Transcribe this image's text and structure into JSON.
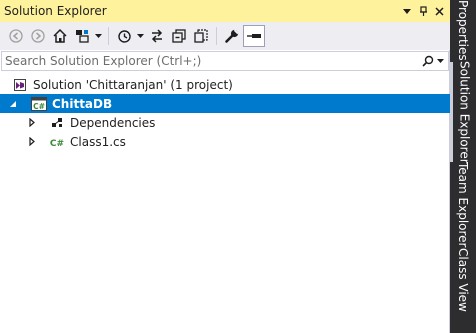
{
  "window": {
    "title": "Solution Explorer",
    "pin_glyph": "▾",
    "autohide_glyph": "⊣",
    "close_glyph": "✕"
  },
  "toolbar": {
    "buttons": [
      {
        "name": "back-button",
        "icon": "arrow-left-icon"
      },
      {
        "name": "forward-button",
        "icon": "arrow-right-icon"
      },
      {
        "name": "home-button",
        "icon": "home-icon"
      },
      {
        "name": "switch-views-button",
        "icon": "switch-views-icon"
      },
      {
        "name": "pending-changes-filter-button",
        "icon": "history-icon"
      },
      {
        "name": "sync-with-document-button",
        "icon": "sync-icon"
      },
      {
        "name": "collapse-all-button",
        "icon": "collapse-all-icon"
      },
      {
        "name": "show-all-files-button",
        "icon": "show-all-files-icon"
      },
      {
        "name": "properties-button",
        "icon": "wrench-icon"
      },
      {
        "name": "preview-selected-items-button",
        "icon": "preview-icon"
      }
    ]
  },
  "search": {
    "placeholder": "Search Solution Explorer (Ctrl+;)"
  },
  "tree": {
    "solution": {
      "label": "Solution 'Chittaranjan' (1 project)",
      "icon": "solution-icon"
    },
    "project": {
      "label": "ChittaDB",
      "icon": "csharp-project-icon",
      "badge": "C#",
      "expanded": true,
      "selected": true
    },
    "children": [
      {
        "label": "Dependencies",
        "icon": "dependencies-icon",
        "expanded": false
      },
      {
        "label": "Class1.cs",
        "icon": "csharp-file-icon",
        "badge": "C#",
        "expanded": false
      }
    ]
  },
  "side_tabs": [
    {
      "label": "Properties",
      "active": false
    },
    {
      "label": "Solution Explorer",
      "active": true
    },
    {
      "label": "Team Explorer",
      "active": false
    },
    {
      "label": "Class View",
      "active": false
    }
  ],
  "colors": {
    "title_bar": "#fff29d",
    "toolbar_bg": "#eeeef2",
    "selection": "#007acc",
    "side_strip": "#2d2d30",
    "csharp_green": "#388a34",
    "solution_purple": "#68217a"
  }
}
